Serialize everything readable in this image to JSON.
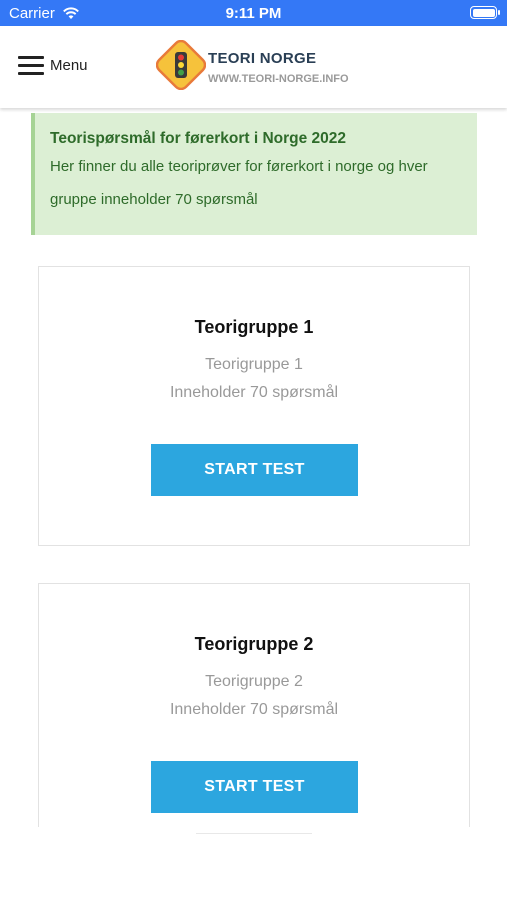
{
  "status_bar": {
    "carrier": "Carrier",
    "time": "9:11 PM",
    "battery_level": 1.0,
    "background": "#3478f6"
  },
  "header": {
    "menu_label": "Menu",
    "logo_title": "TEORI NORGE",
    "logo_url": "WWW.TEORI-NORGE.INFO"
  },
  "notice": {
    "title": "Teorispørsmål for førerkort i Norge 2022",
    "text": "Her finner du alle teoriprøver for førerkort i norge og hver gruppe inneholder 70 spørsmål"
  },
  "cards": [
    {
      "title": "Teorigruppe 1",
      "subtitle": "Teorigruppe 1",
      "count": "Inneholder 70 spørsmål",
      "button": "START TEST"
    },
    {
      "title": "Teorigruppe 2",
      "subtitle": "Teorigruppe 2",
      "count": "Inneholder 70 spørsmål",
      "button": "START TEST"
    }
  ],
  "colors": {
    "accent": "#2ca6df",
    "notice_bg": "#dcefd4",
    "notice_text": "#2e6b2a"
  }
}
